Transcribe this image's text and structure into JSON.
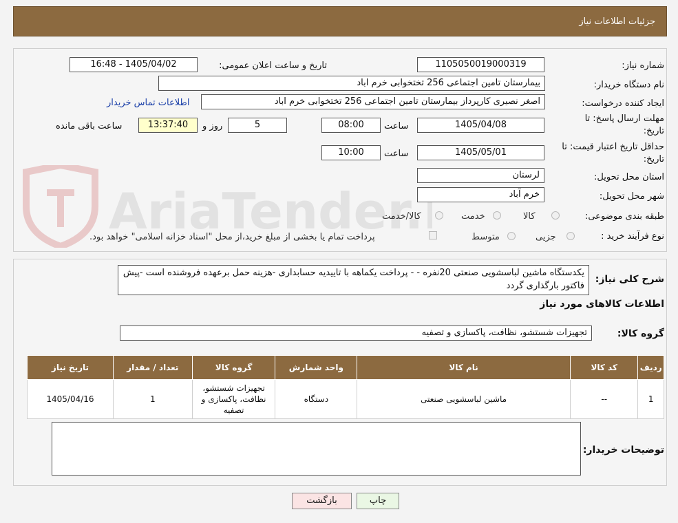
{
  "header": {
    "title": "جزئیات اطلاعات نیاز"
  },
  "watermark": {
    "text": "AriaTender.neT"
  },
  "form": {
    "need_number_label": "شماره نیاز:",
    "need_number": "1105050019000319",
    "announce_label": "تاریخ و ساعت اعلان عمومی:",
    "announce_value": "1405/04/02 - 16:48",
    "buyer_org_label": "نام دستگاه خریدار:",
    "buyer_org": "بیمارستان تامین اجتماعی  256 تختخوابی خرم اباد",
    "creator_label": "ایجاد کننده درخواست:",
    "creator": "اصغر نصیری کارپرداز بیمارستان تامین اجتماعی  256 تختخوابی خرم اباد",
    "contact_link": "اطلاعات تماس خریدار",
    "deadline_label": "مهلت ارسال پاسخ: تا تاریخ:",
    "deadline_date": "1405/04/08",
    "time_label": "ساعت",
    "deadline_time": "08:00",
    "days_value": "5",
    "days_label": "روز و",
    "remaining_time": "13:37:40",
    "remaining_label": "ساعت باقی مانده",
    "validity_label": "حداقل تاریخ اعتبار قیمت: تا تاریخ:",
    "validity_date": "1405/05/01",
    "validity_time": "10:00",
    "province_label": "استان محل تحویل:",
    "province": "لرستان",
    "city_label": "شهر محل تحویل:",
    "city": "خرم آباد",
    "category_label": "طبقه بندی موضوعی:",
    "category_options": [
      "کالا",
      "خدمت",
      "کالا/خدمت"
    ],
    "process_label": "نوع فرآیند خرید :",
    "process_options": [
      "جزیی",
      "متوسط"
    ],
    "payment_note": "پرداخت تمام یا بخشی از مبلغ خرید،از محل \"اسناد خزانه اسلامی\" خواهد بود."
  },
  "description": {
    "label": "شرح کلی نیاز:",
    "text": "یکدستگاه ماشین لباسشویی صنعتی 20نفره -  - پرداخت یکماهه با تاییدیه حسابداری -هزینه حمل برعهده فروشنده است -پیش فاکتور بارگذاری گردد"
  },
  "goods": {
    "section_title": "اطلاعات کالاهای مورد نیاز",
    "group_label": "گروه کالا:",
    "group_value": "تجهیزات شستشو، نظافت، پاکسازی و تصفیه",
    "columns": [
      "ردیف",
      "کد کالا",
      "نام کالا",
      "واحد شمارش",
      "گروه کالا",
      "تعداد / مقدار",
      "تاریخ نیاز"
    ],
    "rows": [
      {
        "row": "1",
        "code": "--",
        "name": "ماشین لباسشویی صنعتی",
        "unit": "دستگاه",
        "group": "تجهیزات شستشو، نظافت، پاکسازی و تصفیه",
        "qty": "1",
        "date": "1405/04/16"
      }
    ]
  },
  "buyer_notes": {
    "label": "توضیحات خریدار:",
    "text": ""
  },
  "buttons": {
    "print": "چاپ",
    "back": "بازگشت"
  }
}
